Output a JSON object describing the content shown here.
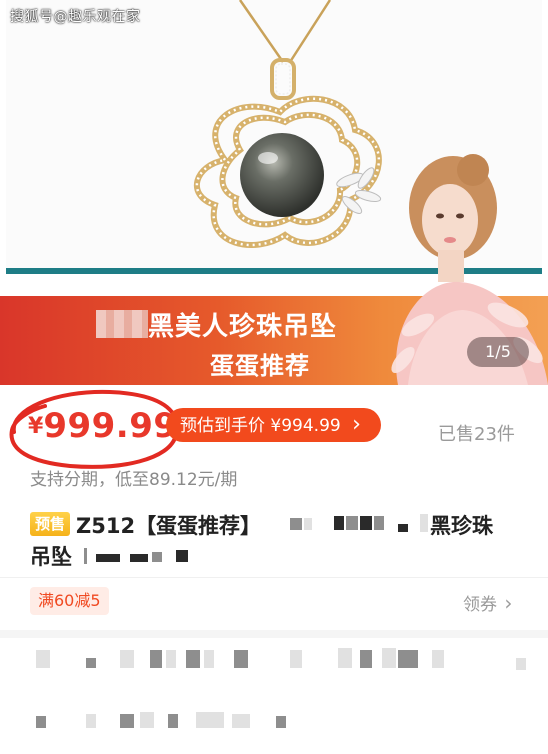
{
  "watermark": "搜狐号@趣乐观在家",
  "banner": {
    "title": "黑美人珍珠吊坠",
    "subtitle": "蛋蛋推荐"
  },
  "gallery": {
    "counter": "1/5"
  },
  "price": {
    "currency": "¥",
    "amount": "999.99",
    "estimate": "预估到手价 ¥994.99",
    "estimate_arrow": "›",
    "sold": "已售23件",
    "color": "#e8382b"
  },
  "installment": "支持分期，低至89.12元/期",
  "product": {
    "badge": "预售",
    "title_line1": "Z512【蛋蛋推荐】",
    "title_line1_end": "黑珍珠",
    "title_line2": "吊坠"
  },
  "promo": {
    "tag": "满60减5",
    "coupon_link": "领券",
    "coupon_arrow": "›"
  },
  "colors": {
    "accent": "#f24a1d",
    "banner_start": "#d9362a",
    "teal": "#1e7d86",
    "presale": "#f5b21a"
  }
}
